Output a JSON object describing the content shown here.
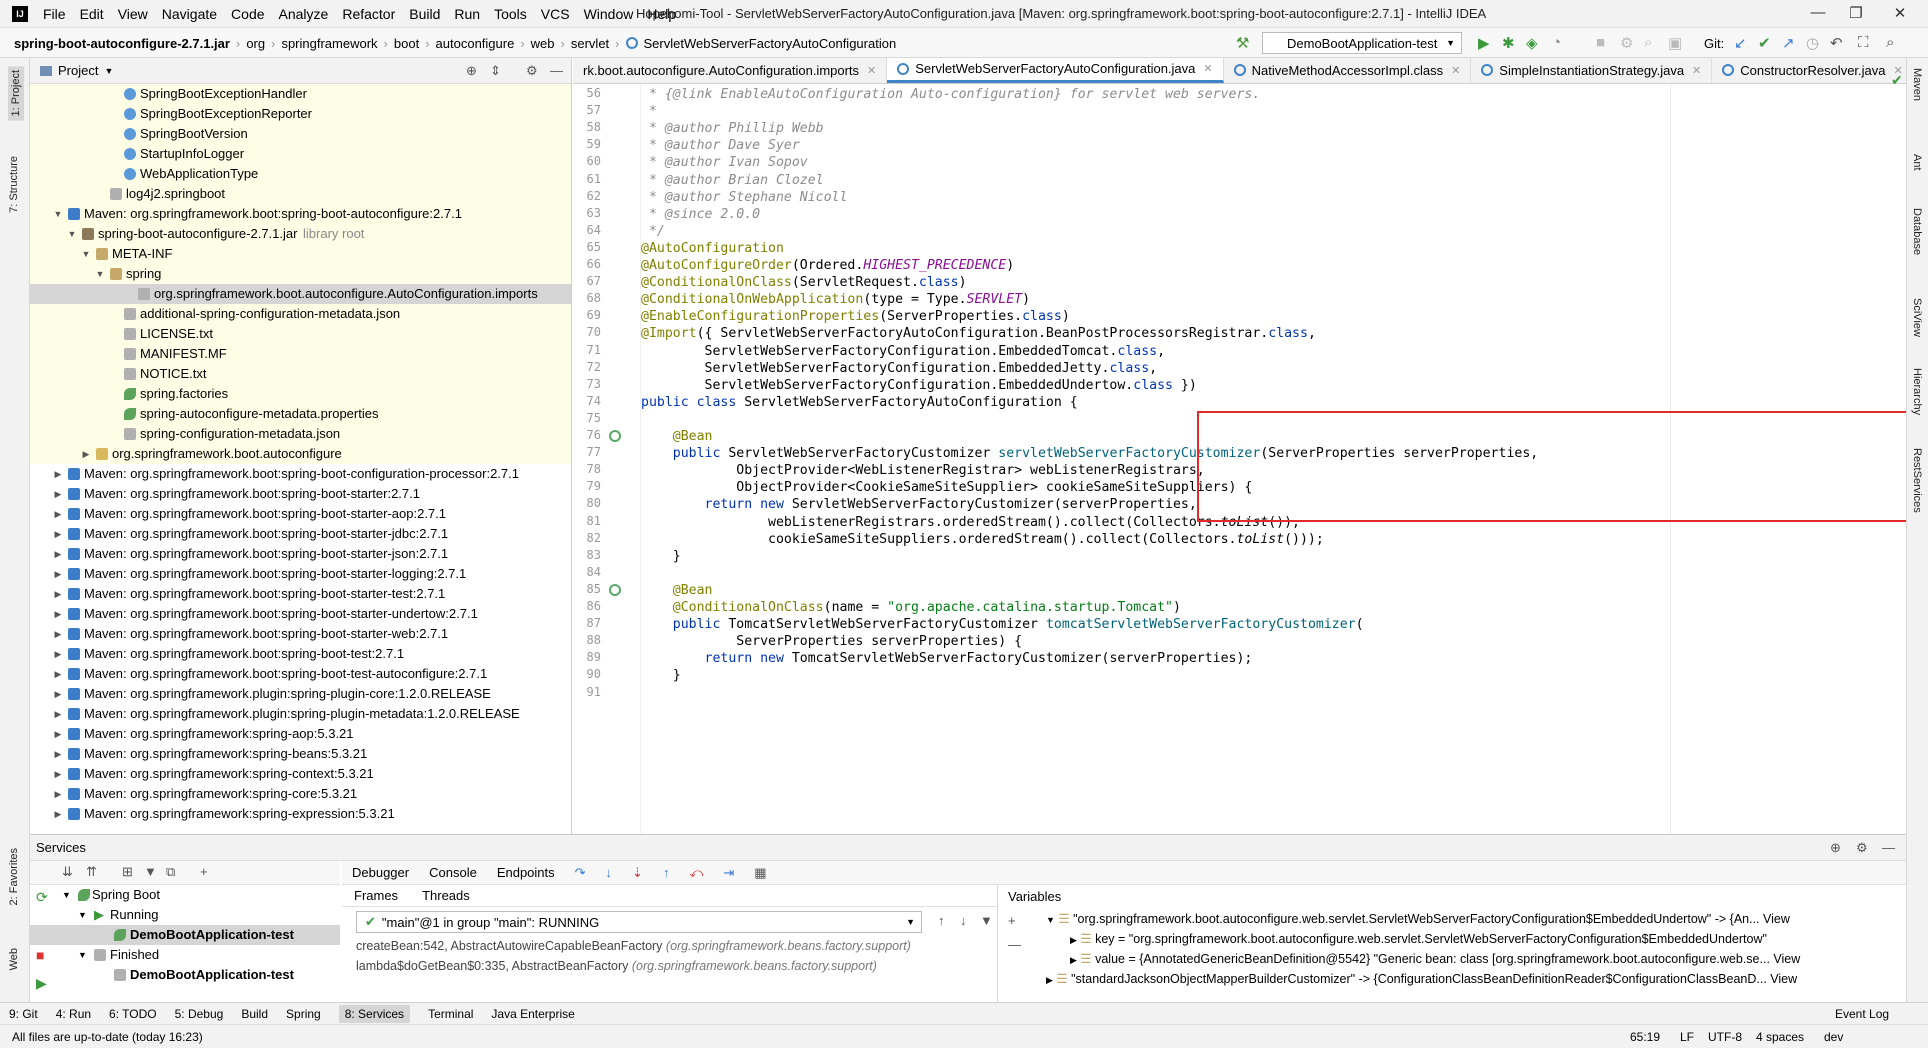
{
  "menu": {
    "items": [
      "File",
      "Edit",
      "View",
      "Navigate",
      "Code",
      "Analyze",
      "Refactor",
      "Build",
      "Run",
      "Tools",
      "VCS",
      "Window",
      "Help"
    ]
  },
  "window_title": "Hopehomi-Tool - ServletWebServerFactoryAutoConfiguration.java [Maven: org.springframework.boot:spring-boot-autoconfigure:2.7.1] - IntelliJ IDEA",
  "breadcrumbs": [
    "spring-boot-autoconfigure-2.7.1.jar",
    "org",
    "springframework",
    "boot",
    "autoconfigure",
    "web",
    "servlet",
    "ServletWebServerFactoryAutoConfiguration"
  ],
  "run_config": "DemoBootApplication-test",
  "git_label": "Git:",
  "project": {
    "title": "Project",
    "tree": [
      {
        "label": "SpringBootExceptionHandler",
        "depth": 5,
        "icon": "class-icon",
        "hl": true
      },
      {
        "label": "SpringBootExceptionReporter",
        "depth": 5,
        "icon": "class-icon",
        "hl": true
      },
      {
        "label": "SpringBootVersion",
        "depth": 5,
        "icon": "class-icon",
        "hl": true
      },
      {
        "label": "StartupInfoLogger",
        "depth": 5,
        "icon": "class-icon",
        "hl": true
      },
      {
        "label": "WebApplicationType",
        "depth": 5,
        "icon": "class-icon",
        "hl": true
      },
      {
        "label": "log4j2.springboot",
        "depth": 4,
        "icon": "file-icon",
        "hl": true
      },
      {
        "label": "Maven: org.springframework.boot:spring-boot-autoconfigure:2.7.1",
        "depth": 1,
        "icon": "maven-icon",
        "arrow": "▼",
        "hl": true
      },
      {
        "label": "spring-boot-autoconfigure-2.7.1.jar",
        "suffix": "library root",
        "depth": 2,
        "icon": "jar-icon",
        "arrow": "▼",
        "hl": true
      },
      {
        "label": "META-INF",
        "depth": 3,
        "icon": "folder-icon",
        "arrow": "▼",
        "hl": true
      },
      {
        "label": "spring",
        "depth": 4,
        "icon": "folder-icon",
        "arrow": "▼",
        "hl": true
      },
      {
        "label": "org.springframework.boot.autoconfigure.AutoConfiguration.imports",
        "depth": 6,
        "icon": "file-icon",
        "sel": true
      },
      {
        "label": "additional-spring-configuration-metadata.json",
        "depth": 5,
        "icon": "file-icon",
        "hl": true
      },
      {
        "label": "LICENSE.txt",
        "depth": 5,
        "icon": "file-icon",
        "hl": true
      },
      {
        "label": "MANIFEST.MF",
        "depth": 5,
        "icon": "file-icon",
        "hl": true
      },
      {
        "label": "NOTICE.txt",
        "depth": 5,
        "icon": "file-icon",
        "hl": true
      },
      {
        "label": "spring.factories",
        "depth": 5,
        "icon": "leaf-icon",
        "hl": true
      },
      {
        "label": "spring-autoconfigure-metadata.properties",
        "depth": 5,
        "icon": "leaf-icon",
        "hl": true
      },
      {
        "label": "spring-configuration-metadata.json",
        "depth": 5,
        "icon": "file-icon",
        "hl": true
      },
      {
        "label": "org.springframework.boot.autoconfigure",
        "depth": 3,
        "icon": "package-icon",
        "arrow": "▶",
        "hl": true
      },
      {
        "label": "Maven: org.springframework.boot:spring-boot-configuration-processor:2.7.1",
        "depth": 1,
        "icon": "maven-icon",
        "arrow": "▶"
      },
      {
        "label": "Maven: org.springframework.boot:spring-boot-starter:2.7.1",
        "depth": 1,
        "icon": "maven-icon",
        "arrow": "▶"
      },
      {
        "label": "Maven: org.springframework.boot:spring-boot-starter-aop:2.7.1",
        "depth": 1,
        "icon": "maven-icon",
        "arrow": "▶"
      },
      {
        "label": "Maven: org.springframework.boot:spring-boot-starter-jdbc:2.7.1",
        "depth": 1,
        "icon": "maven-icon",
        "arrow": "▶"
      },
      {
        "label": "Maven: org.springframework.boot:spring-boot-starter-json:2.7.1",
        "depth": 1,
        "icon": "maven-icon",
        "arrow": "▶"
      },
      {
        "label": "Maven: org.springframework.boot:spring-boot-starter-logging:2.7.1",
        "depth": 1,
        "icon": "maven-icon",
        "arrow": "▶"
      },
      {
        "label": "Maven: org.springframework.boot:spring-boot-starter-test:2.7.1",
        "depth": 1,
        "icon": "maven-icon",
        "arrow": "▶"
      },
      {
        "label": "Maven: org.springframework.boot:spring-boot-starter-undertow:2.7.1",
        "depth": 1,
        "icon": "maven-icon",
        "arrow": "▶"
      },
      {
        "label": "Maven: org.springframework.boot:spring-boot-starter-web:2.7.1",
        "depth": 1,
        "icon": "maven-icon",
        "arrow": "▶"
      },
      {
        "label": "Maven: org.springframework.boot:spring-boot-test:2.7.1",
        "depth": 1,
        "icon": "maven-icon",
        "arrow": "▶"
      },
      {
        "label": "Maven: org.springframework.boot:spring-boot-test-autoconfigure:2.7.1",
        "depth": 1,
        "icon": "maven-icon",
        "arrow": "▶"
      },
      {
        "label": "Maven: org.springframework.plugin:spring-plugin-core:1.2.0.RELEASE",
        "depth": 1,
        "icon": "maven-icon",
        "arrow": "▶"
      },
      {
        "label": "Maven: org.springframework.plugin:spring-plugin-metadata:1.2.0.RELEASE",
        "depth": 1,
        "icon": "maven-icon",
        "arrow": "▶"
      },
      {
        "label": "Maven: org.springframework:spring-aop:5.3.21",
        "depth": 1,
        "icon": "maven-icon",
        "arrow": "▶"
      },
      {
        "label": "Maven: org.springframework:spring-beans:5.3.21",
        "depth": 1,
        "icon": "maven-icon",
        "arrow": "▶"
      },
      {
        "label": "Maven: org.springframework:spring-context:5.3.21",
        "depth": 1,
        "icon": "maven-icon",
        "arrow": "▶"
      },
      {
        "label": "Maven: org.springframework:spring-core:5.3.21",
        "depth": 1,
        "icon": "maven-icon",
        "arrow": "▶"
      },
      {
        "label": "Maven: org.springframework:spring-expression:5.3.21",
        "depth": 1,
        "icon": "maven-icon",
        "arrow": "▶"
      }
    ]
  },
  "editor": {
    "tabs": [
      {
        "label": "rk.boot.autoconfigure.AutoConfiguration.imports",
        "active": false
      },
      {
        "label": "ServletWebServerFactoryAutoConfiguration.java",
        "active": true
      },
      {
        "label": "NativeMethodAccessorImpl.class",
        "active": false
      },
      {
        "label": "SimpleInstantiationStrategy.java",
        "active": false
      },
      {
        "label": "ConstructorResolver.java",
        "active": false
      }
    ],
    "lines": [
      {
        "n": "56",
        "segs": [
          [
            " * {",
            "cmt"
          ],
          [
            "@link",
            "cmt"
          ],
          [
            " EnableAutoConfiguration Auto-configuration} for servlet web servers.",
            "cmt"
          ]
        ]
      },
      {
        "n": "57",
        "segs": [
          [
            " *",
            "cmt"
          ]
        ]
      },
      {
        "n": "58",
        "segs": [
          [
            " * @author Phillip Webb",
            "cmt"
          ]
        ]
      },
      {
        "n": "59",
        "segs": [
          [
            " * @author Dave Syer",
            "cmt"
          ]
        ]
      },
      {
        "n": "60",
        "segs": [
          [
            " * @author Ivan Sopov",
            "cmt"
          ]
        ]
      },
      {
        "n": "61",
        "segs": [
          [
            " * @author Brian Clozel",
            "cmt"
          ]
        ]
      },
      {
        "n": "62",
        "segs": [
          [
            " * @author Stephane Nicoll",
            "cmt"
          ]
        ]
      },
      {
        "n": "63",
        "segs": [
          [
            " * @since 2.0.0",
            "cmt"
          ]
        ]
      },
      {
        "n": "64",
        "segs": [
          [
            " */",
            "cmt"
          ]
        ]
      },
      {
        "n": "65",
        "segs": [
          [
            "@AutoConfiguration",
            "ann"
          ]
        ]
      },
      {
        "n": "66",
        "segs": [
          [
            "@AutoConfigureOrder",
            "ann"
          ],
          [
            "(Ordered.",
            ""
          ],
          [
            "HIGHEST_PRECEDENCE",
            "const"
          ],
          [
            ")",
            ""
          ]
        ]
      },
      {
        "n": "67",
        "segs": [
          [
            "@ConditionalOnClass",
            "ann"
          ],
          [
            "(ServletRequest.",
            ""
          ],
          [
            "class",
            "kw"
          ],
          [
            ")",
            ""
          ]
        ]
      },
      {
        "n": "68",
        "segs": [
          [
            "@ConditionalOnWebApplication",
            "ann"
          ],
          [
            "(type = Type.",
            ""
          ],
          [
            "SERVLET",
            "const"
          ],
          [
            ")",
            ""
          ]
        ]
      },
      {
        "n": "69",
        "segs": [
          [
            "@EnableConfigurationProperties",
            "ann"
          ],
          [
            "(ServerProperties.",
            ""
          ],
          [
            "class",
            "kw"
          ],
          [
            ")",
            ""
          ]
        ]
      },
      {
        "n": "70",
        "segs": [
          [
            "@Import",
            "ann"
          ],
          [
            "({ ServletWebServerFactoryAutoConfiguration.BeanPostProcessorsRegistrar.",
            ""
          ],
          [
            "class",
            "kw"
          ],
          [
            ",",
            ""
          ]
        ]
      },
      {
        "n": "71",
        "segs": [
          [
            "        ServletWebServerFactoryConfiguration.EmbeddedTomcat.",
            ""
          ],
          [
            "class",
            "kw"
          ],
          [
            ",",
            ""
          ]
        ]
      },
      {
        "n": "72",
        "segs": [
          [
            "        ServletWebServerFactoryConfiguration.EmbeddedJetty.",
            ""
          ],
          [
            "class",
            "kw"
          ],
          [
            ",",
            ""
          ]
        ]
      },
      {
        "n": "73",
        "segs": [
          [
            "        ServletWebServerFactoryConfiguration.EmbeddedUndertow.",
            ""
          ],
          [
            "class",
            "kw"
          ],
          [
            " })",
            ""
          ]
        ]
      },
      {
        "n": "74",
        "segs": [
          [
            "public class ",
            "kw"
          ],
          [
            "ServletWebServerFactoryAutoConfiguration {",
            ""
          ]
        ]
      },
      {
        "n": "75",
        "segs": [
          [
            "",
            ""
          ]
        ]
      },
      {
        "n": "76",
        "segs": [
          [
            "    @Bean",
            "ann"
          ]
        ]
      },
      {
        "n": "77",
        "segs": [
          [
            "    public ",
            "kw"
          ],
          [
            "ServletWebServerFactoryCustomizer ",
            ""
          ],
          [
            "servletWebServerFactoryCustomizer",
            "fn"
          ],
          [
            "(ServerProperties serverProperties,",
            ""
          ]
        ]
      },
      {
        "n": "78",
        "segs": [
          [
            "            ObjectProvider<WebListenerRegistrar> webListenerRegistrars,",
            ""
          ]
        ]
      },
      {
        "n": "79",
        "segs": [
          [
            "            ObjectProvider<CookieSameSiteSupplier> cookieSameSiteSuppliers) {",
            ""
          ]
        ]
      },
      {
        "n": "80",
        "segs": [
          [
            "        return new ",
            "kw"
          ],
          [
            "ServletWebServerFactoryCustomizer(serverProperties,",
            ""
          ]
        ]
      },
      {
        "n": "81",
        "segs": [
          [
            "                webListenerRegistrars.orderedStream().collect(Collectors.",
            ""
          ],
          [
            "toList",
            "stat"
          ],
          [
            "()),",
            ""
          ]
        ]
      },
      {
        "n": "82",
        "segs": [
          [
            "                cookieSameSiteSuppliers.orderedStream().collect(Collectors.",
            ""
          ],
          [
            "toList",
            "stat"
          ],
          [
            "()));",
            ""
          ]
        ]
      },
      {
        "n": "83",
        "segs": [
          [
            "    }",
            ""
          ]
        ]
      },
      {
        "n": "84",
        "segs": [
          [
            "",
            ""
          ]
        ]
      },
      {
        "n": "85",
        "segs": [
          [
            "    @Bean",
            "ann"
          ]
        ]
      },
      {
        "n": "86",
        "segs": [
          [
            "    @ConditionalOnClass",
            "ann"
          ],
          [
            "(name = ",
            ""
          ],
          [
            "\"org.apache.catalina.startup.Tomcat\"",
            "str"
          ],
          [
            ")",
            ""
          ]
        ]
      },
      {
        "n": "87",
        "segs": [
          [
            "    public ",
            "kw"
          ],
          [
            "TomcatServletWebServerFactoryCustomizer ",
            ""
          ],
          [
            "tomcatServletWebServerFactoryCustomizer",
            "fn"
          ],
          [
            "(",
            ""
          ]
        ]
      },
      {
        "n": "88",
        "segs": [
          [
            "            ServerProperties serverProperties) {",
            ""
          ]
        ]
      },
      {
        "n": "89",
        "segs": [
          [
            "        return new ",
            "kw"
          ],
          [
            "TomcatServletWebServerFactoryCustomizer(serverProperties);",
            ""
          ]
        ]
      },
      {
        "n": "90",
        "segs": [
          [
            "    }",
            ""
          ]
        ]
      },
      {
        "n": "91",
        "segs": [
          [
            "",
            ""
          ]
        ]
      }
    ]
  },
  "services": {
    "title": "Services",
    "tree": [
      "Spring Boot",
      "Running",
      "DemoBootApplication-test",
      "Finished",
      "DemoBootApplication-test"
    ],
    "debug_tabs": [
      "Debugger",
      "Console",
      "Endpoints"
    ],
    "frames_label": "Frames",
    "threads_label": "Threads",
    "thread_select": "\"main\"@1 in group \"main\": RUNNING",
    "frames": [
      {
        "text": "createBean:542, AbstractAutowireCapableBeanFactory ",
        "pkg": "(org.springframework.beans.factory.support)"
      },
      {
        "text": "lambda$doGetBean$0:335, AbstractBeanFactory ",
        "pkg": "(org.springframework.beans.factory.support)"
      }
    ],
    "variables_label": "Variables",
    "variables": [
      "\"org.springframework.boot.autoconfigure.web.servlet.ServletWebServerFactoryConfiguration$EmbeddedUndertow\" -> {An...  View",
      "key = \"org.springframework.boot.autoconfigure.web.servlet.ServletWebServerFactoryConfiguration$EmbeddedUndertow\"",
      "value = {AnnotatedGenericBeanDefinition@5542} \"Generic bean: class [org.springframework.boot.autoconfigure.web.se...  View",
      "\"standardJacksonObjectMapperBuilderCustomizer\" -> {ConfigurationClassBeanDefinitionReader$ConfigurationClassBeanD...  View"
    ]
  },
  "bottom_tabs": [
    "9: Git",
    "4: Run",
    "6: TODO",
    "5: Debug",
    "Build",
    "Spring",
    "8: Services",
    "Terminal",
    "Java Enterprise"
  ],
  "event_log": "Event Log",
  "status": {
    "message": "All files are up-to-date (today 16:23)",
    "position": "65:19",
    "line_sep": "LF",
    "encoding": "UTF-8",
    "indent": "4 spaces",
    "branch": "dev"
  },
  "side_tabs": {
    "left": [
      "1: Project",
      "7: Structure",
      "2: Favorites",
      "Web"
    ],
    "right": [
      "Maven",
      "Ant",
      "Database",
      "SciView",
      "Hierarchy",
      "RestServices"
    ]
  }
}
